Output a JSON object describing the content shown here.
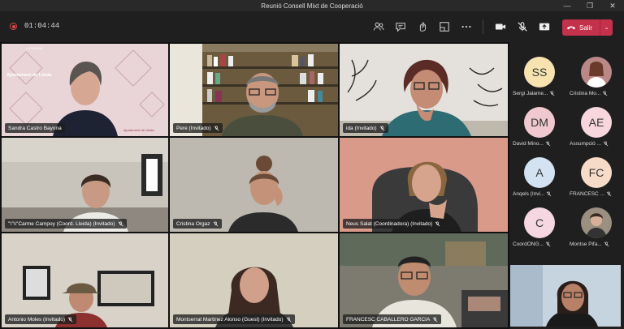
{
  "window": {
    "title": "Reunió Consell Mixt de Cooperació"
  },
  "toolbar": {
    "timer": "01:04:44",
    "leave_label": "Salir"
  },
  "tiles": [
    {
      "name": "Sandra Castro Bayona",
      "sign_small": "LA PAERIA",
      "sign_main": "Ajuntament de Lleida",
      "sign_logo": "Ajuntament de Lleida"
    },
    {
      "name": "Pere (Invitado)"
    },
    {
      "name": "ida (Invitado)"
    },
    {
      "name": "\"\\\"\\\\\"Carme Campoy (Coord. Lleida) (Invitado)"
    },
    {
      "name": "Cristina Orgaz"
    },
    {
      "name": "Neus Salat (Coordinadora) (Invitado)"
    },
    {
      "name": "Antonio Moles (Invitado)"
    },
    {
      "name": "Montserrat Martinez Alonso (Guest) (Invitado)"
    },
    {
      "name": "FRANCESC CABALLERO GARCIA"
    }
  ],
  "roster": [
    {
      "initials": "SS",
      "name": "Sergi Jalame...",
      "color": "#f6e3b0"
    },
    {
      "initials": "",
      "name": "Cristina Mo...",
      "color": "#c99"
    },
    {
      "initials": "DM",
      "name": "David Mino...",
      "color": "#f0c8d0"
    },
    {
      "initials": "AE",
      "name": "Assumpció ...",
      "color": "#f7d6dd"
    },
    {
      "initials": "A",
      "name": "Anqels (Invi...",
      "color": "#d4e3f2"
    },
    {
      "initials": "FC",
      "name": "FRANCESC ...",
      "color": "#f6dcc8"
    },
    {
      "initials": "C",
      "name": "CoordONG...",
      "color": "#f5d7e1"
    },
    {
      "initials": "",
      "name": "Montse Pifa...",
      "color": "#9a8f80"
    }
  ],
  "colors": {
    "accent": "#6264a7",
    "leave": "#c4314b"
  }
}
